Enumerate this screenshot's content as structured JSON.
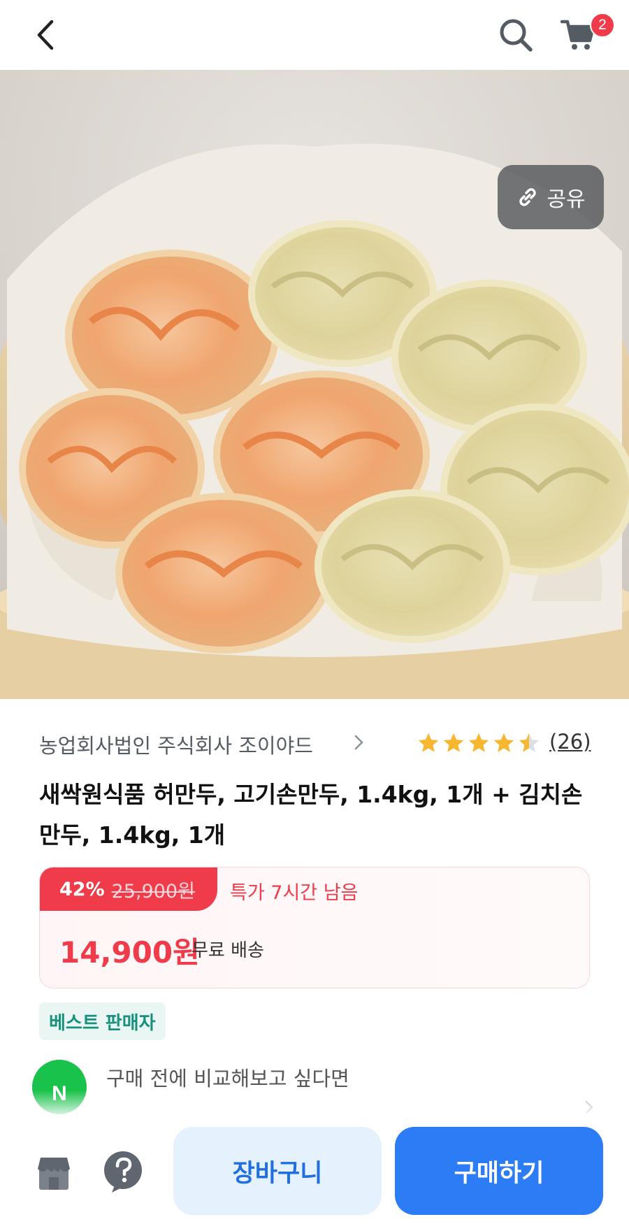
{
  "header": {
    "back_icon": "chevron-left-icon",
    "search_icon": "search-icon",
    "cart_icon": "cart-icon",
    "cart_count": "2"
  },
  "image": {
    "share_label": "공유",
    "share_icon": "link-icon"
  },
  "product": {
    "seller": "농업회사법인 주식회사 조이야드",
    "rating": 4.5,
    "review_count": "(26)",
    "title": "새싹원식품 허만두, 고기손만두, 1.4kg, 1개 + 김치손만두, 1.4kg, 1개"
  },
  "price": {
    "discount_rate": "42%",
    "original_price": "25,900원",
    "deal_timer": "특가 7시간 남음",
    "sale_price": "14,900원",
    "shipping": "무료 배송"
  },
  "badge": {
    "label": "베스트 판매자"
  },
  "compare": {
    "logo_text": "N",
    "text": "구매 전에 비교해보고 싶다면"
  },
  "bottom_bar": {
    "store_icon": "store-icon",
    "help_icon": "question-icon",
    "cart_label": "장바구니",
    "buy_label": "구매하기"
  },
  "colors": {
    "accent_red": "#ef3b4a",
    "accent_blue": "#2b7cf5",
    "best_green": "#17907c",
    "star": "#f7b731"
  }
}
